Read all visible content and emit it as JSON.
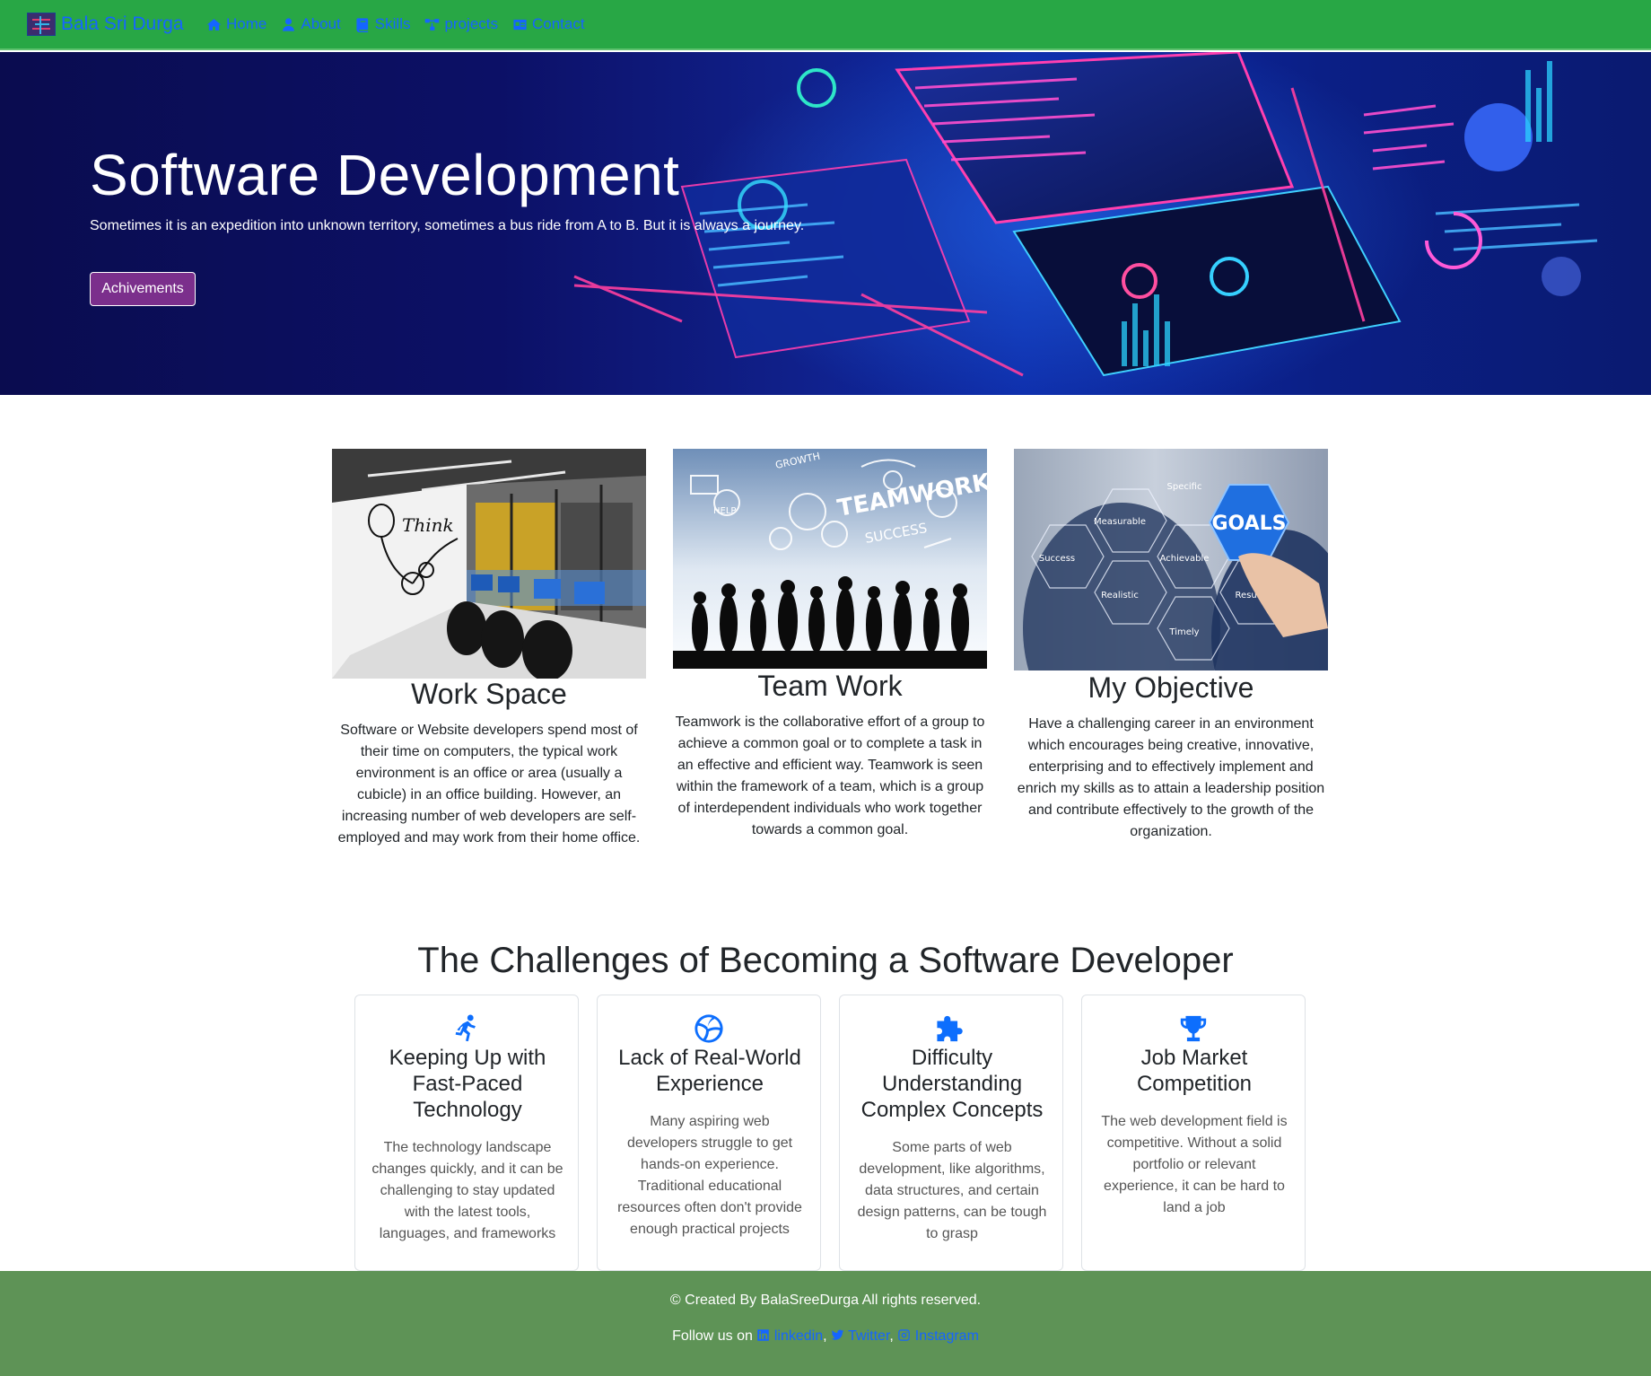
{
  "navbar": {
    "brand": "Bala Sri Durga",
    "links": [
      {
        "label": "Home",
        "icon": "home-icon"
      },
      {
        "label": "About",
        "icon": "user-icon"
      },
      {
        "label": "Skills",
        "icon": "book-icon"
      },
      {
        "label": "projects",
        "icon": "network-icon"
      },
      {
        "label": "Contact",
        "icon": "id-card-icon"
      }
    ],
    "accent": "#28a745",
    "link_color": "#1565ff"
  },
  "hero": {
    "title": "Software Development",
    "subtitle": "Sometimes it is an expedition into unknown territory, sometimes a bus ride from A to B. But it is always a journey.",
    "button_label": "Achivements",
    "button_color": "#7b2f8c"
  },
  "features": [
    {
      "title": "Work Space",
      "text": "Software or Website developers spend most of their time on computers, the typical work environment is an office or area (usually a cubicle) in an office building. However, an increasing number of web developers are self-employed and may work from their home office.",
      "image_text": "Think"
    },
    {
      "title": "Team Work",
      "text": "Teamwork is the collaborative effort of a group to achieve a common goal or to complete a task in an effective and efficient way. Teamwork is seen within the framework of a team, which is a group of interdependent individuals who work together towards a common goal.",
      "image_text": [
        "TEAMWORK",
        "SUCCESS",
        "GROWTH",
        "HELP"
      ]
    },
    {
      "title": "My Objective",
      "text": "Have a challenging career in an environment which encourages being creative, innovative, enterprising and to effectively implement and enrich my skills as to attain a leadership position and contribute effectively to the growth of the organization.",
      "image_text": [
        "GOALS",
        "Specific",
        "Measurable",
        "Achievable",
        "Realistic",
        "Timely",
        "Success",
        "Result"
      ]
    }
  ],
  "challenges": {
    "title": "The Challenges of Becoming a Software Developer",
    "cards": [
      {
        "icon": "running-person-icon",
        "title": "Keeping Up with Fast-Paced Technology",
        "text": "The technology landscape changes quickly, and it can be challenging to stay updated with the latest tools, languages, and frameworks"
      },
      {
        "icon": "basketball-icon",
        "title": "Lack of Real-World Experience",
        "text": "Many aspiring web developers struggle to get hands-on experience. Traditional educational resources often don't provide enough practical projects"
      },
      {
        "icon": "puzzle-icon",
        "title": "Difficulty Understanding Complex Concepts",
        "text": "Some parts of web development, like algorithms, data structures, and certain design patterns, can be tough to grasp"
      },
      {
        "icon": "trophy-icon",
        "title": "Job Market Competition",
        "text": "The web development field is competitive. Without a solid portfolio or relevant experience, it can be hard to land a job"
      }
    ],
    "icon_color": "#0d6efd"
  },
  "footer": {
    "copyright": "© Created By BalaSreeDurga All rights reserved.",
    "follow_prefix": "Follow us on",
    "links": [
      {
        "label": "linkedin",
        "icon": "linkedin-icon"
      },
      {
        "label": "Twitter",
        "icon": "twitter-icon"
      },
      {
        "label": "Instagram",
        "icon": "instagram-icon"
      }
    ],
    "separator": ",",
    "background": "#5e9356"
  }
}
